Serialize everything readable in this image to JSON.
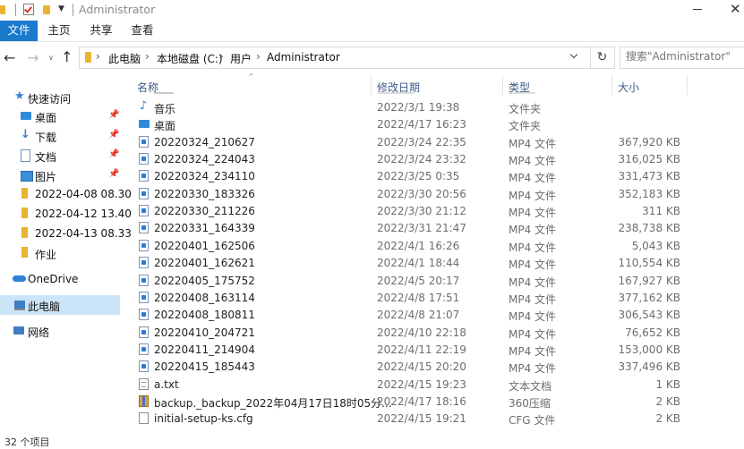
{
  "window": {
    "title": "Administrator"
  },
  "ribbon": {
    "tabs": [
      {
        "label": "文件",
        "active": true
      },
      {
        "label": "主页"
      },
      {
        "label": "共享"
      },
      {
        "label": "查看"
      }
    ]
  },
  "address": {
    "crumbs": [
      "此电脑",
      "本地磁盘 (C:)",
      "用户",
      "Administrator"
    ]
  },
  "search": {
    "placeholder": "搜索\"Administrator\""
  },
  "sidebar": {
    "items": [
      {
        "label": "快速访问",
        "icon": "star-icon"
      },
      {
        "label": "桌面",
        "icon": "desktop-icon",
        "pinned": true
      },
      {
        "label": "下载",
        "icon": "download-icon",
        "pinned": true
      },
      {
        "label": "文档",
        "icon": "document-icon",
        "pinned": true
      },
      {
        "label": "图片",
        "icon": "picture-icon",
        "pinned": true
      },
      {
        "label": "2022-04-08 08.30",
        "icon": "folder-icon"
      },
      {
        "label": "2022-04-12 13.40",
        "icon": "folder-icon"
      },
      {
        "label": "2022-04-13 08.33",
        "icon": "folder-icon"
      },
      {
        "label": "作业",
        "icon": "folder-icon"
      },
      {
        "label": "OneDrive",
        "icon": "cloud-icon"
      },
      {
        "label": "此电脑",
        "icon": "computer-icon",
        "selected": true
      },
      {
        "label": "网络",
        "icon": "network-icon"
      }
    ]
  },
  "columns": {
    "name": "名称",
    "date": "修改日期",
    "type": "类型",
    "size": "大小"
  },
  "files": [
    {
      "name": "音乐",
      "date": "2022/3/1 19:38",
      "type": "文件夹",
      "size": "",
      "icon": "music-icon"
    },
    {
      "name": "桌面",
      "date": "2022/4/17 16:23",
      "type": "文件夹",
      "size": "",
      "icon": "desktop-icon"
    },
    {
      "name": "20220324_210627",
      "date": "2022/3/24 22:35",
      "type": "MP4 文件",
      "size": "367,920 KB",
      "icon": "mp4-icon"
    },
    {
      "name": "20220324_224043",
      "date": "2022/3/24 23:32",
      "type": "MP4 文件",
      "size": "316,025 KB",
      "icon": "mp4-icon"
    },
    {
      "name": "20220324_234110",
      "date": "2022/3/25 0:35",
      "type": "MP4 文件",
      "size": "331,473 KB",
      "icon": "mp4-icon"
    },
    {
      "name": "20220330_183326",
      "date": "2022/3/30 20:56",
      "type": "MP4 文件",
      "size": "352,183 KB",
      "icon": "mp4-icon"
    },
    {
      "name": "20220330_211226",
      "date": "2022/3/30 21:12",
      "type": "MP4 文件",
      "size": "311 KB",
      "icon": "mp4-icon"
    },
    {
      "name": "20220331_164339",
      "date": "2022/3/31 21:47",
      "type": "MP4 文件",
      "size": "238,738 KB",
      "icon": "mp4-icon"
    },
    {
      "name": "20220401_162506",
      "date": "2022/4/1 16:26",
      "type": "MP4 文件",
      "size": "5,043 KB",
      "icon": "mp4-icon"
    },
    {
      "name": "20220401_162621",
      "date": "2022/4/1 18:44",
      "type": "MP4 文件",
      "size": "110,554 KB",
      "icon": "mp4-icon"
    },
    {
      "name": "20220405_175752",
      "date": "2022/4/5 20:17",
      "type": "MP4 文件",
      "size": "167,927 KB",
      "icon": "mp4-icon"
    },
    {
      "name": "20220408_163114",
      "date": "2022/4/8 17:51",
      "type": "MP4 文件",
      "size": "377,162 KB",
      "icon": "mp4-icon"
    },
    {
      "name": "20220408_180811",
      "date": "2022/4/8 21:07",
      "type": "MP4 文件",
      "size": "306,543 KB",
      "icon": "mp4-icon"
    },
    {
      "name": "20220410_204721",
      "date": "2022/4/10 22:18",
      "type": "MP4 文件",
      "size": "76,652 KB",
      "icon": "mp4-icon"
    },
    {
      "name": "20220411_214904",
      "date": "2022/4/11 22:19",
      "type": "MP4 文件",
      "size": "153,000 KB",
      "icon": "mp4-icon"
    },
    {
      "name": "20220415_185443",
      "date": "2022/4/15 20:20",
      "type": "MP4 文件",
      "size": "337,496 KB",
      "icon": "mp4-icon"
    },
    {
      "name": "a.txt",
      "date": "2022/4/15 19:23",
      "type": "文本文档",
      "size": "1 KB",
      "icon": "text-file-icon"
    },
    {
      "name": "backup._backup_2022年04月17日18时05分...",
      "date": "2022/4/17 18:16",
      "type": "360压缩",
      "size": "2 KB",
      "icon": "archive-icon"
    },
    {
      "name": "initial-setup-ks.cfg",
      "date": "2022/4/15 19:21",
      "type": "CFG 文件",
      "size": "2 KB",
      "icon": "cfg-file-icon"
    }
  ],
  "status": {
    "item_count": "32 个项目"
  },
  "colors": {
    "accent": "#1979ca",
    "selection": "#cce4f7",
    "folder": "#e8b431",
    "header_text": "#3c5a8a"
  }
}
